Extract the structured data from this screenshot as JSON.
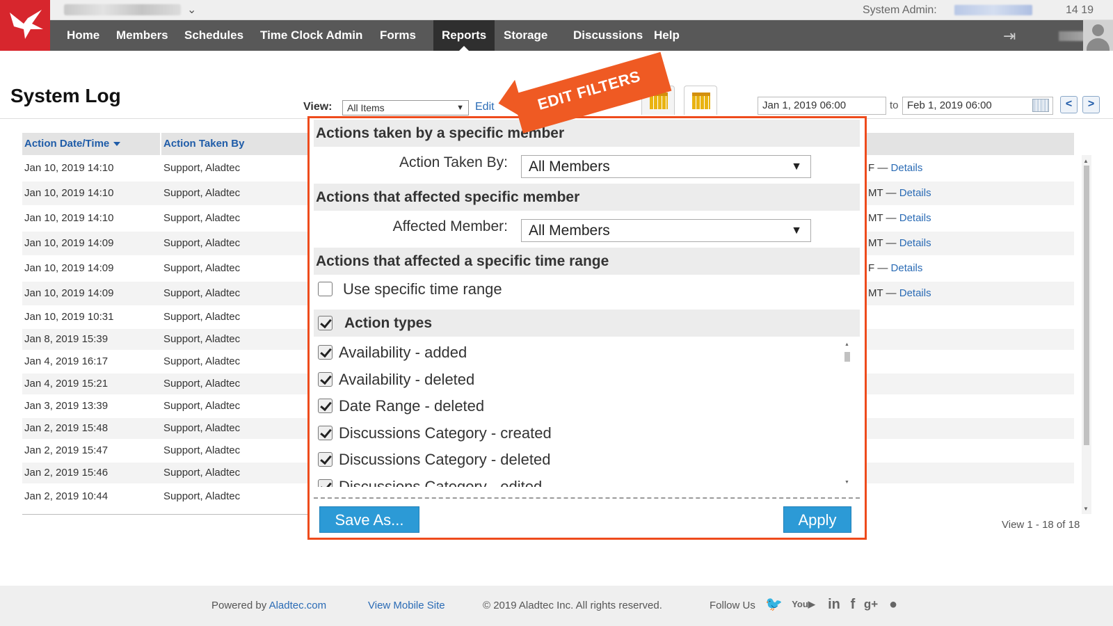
{
  "header": {
    "admin_label": "System Admin:",
    "clock": "14 19"
  },
  "nav": {
    "items": [
      "Home",
      "Members",
      "Schedules",
      "Time Clock Admin",
      "Forms",
      "Reports",
      "Storage",
      "Discussions",
      "Help"
    ],
    "active": "Reports"
  },
  "page": {
    "title": "System Log",
    "view_label": "View:",
    "view_value": "All Items",
    "edit_link": "Edit",
    "date_from": "Jan 1, 2019 06:00",
    "to_label": "to",
    "date_to": "Feb 1, 2019 06:00",
    "prev": "<",
    "next": ">",
    "view_count": "View 1 - 18 of 18"
  },
  "table": {
    "headers": [
      "Action Date/Time",
      "Action Taken By"
    ],
    "rows": [
      {
        "date": "Jan 10, 2019 14:10",
        "by": "Support, Aladtec",
        "suffix": "F —",
        "details": "Details"
      },
      {
        "date": "Jan 10, 2019 14:10",
        "by": "Support, Aladtec",
        "suffix": "MT —",
        "details": "Details"
      },
      {
        "date": "Jan 10, 2019 14:10",
        "by": "Support, Aladtec",
        "suffix": "MT —",
        "details": "Details"
      },
      {
        "date": "Jan 10, 2019 14:09",
        "by": "Support, Aladtec",
        "suffix": "MT —",
        "details": "Details"
      },
      {
        "date": "Jan 10, 2019 14:09",
        "by": "Support, Aladtec",
        "suffix": "F —",
        "details": "Details"
      },
      {
        "date": "Jan 10, 2019 14:09",
        "by": "Support, Aladtec",
        "suffix": "MT —",
        "details": "Details"
      },
      {
        "date": "Jan 10, 2019 10:31",
        "by": "Support, Aladtec",
        "suffix": "",
        "details": ""
      },
      {
        "date": "Jan 8, 2019 15:39",
        "by": "Support, Aladtec",
        "suffix": "",
        "details": ""
      },
      {
        "date": "Jan 4, 2019 16:17",
        "by": "Support, Aladtec",
        "suffix": "",
        "details": ""
      },
      {
        "date": "Jan 4, 2019 15:21",
        "by": "Support, Aladtec",
        "suffix": "",
        "details": ""
      },
      {
        "date": "Jan 3, 2019 13:39",
        "by": "Support, Aladtec",
        "suffix": "",
        "details": ""
      },
      {
        "date": "Jan 2, 2019 15:48",
        "by": "Support, Aladtec",
        "suffix": "",
        "details": ""
      },
      {
        "date": "Jan 2, 2019 15:47",
        "by": "Support, Aladtec",
        "suffix": "",
        "details": ""
      },
      {
        "date": "Jan 2, 2019 15:46",
        "by": "Support, Aladtec",
        "suffix": "",
        "details": ""
      },
      {
        "date": "Jan 2, 2019 10:44",
        "by": "Support, Aladtec",
        "suffix": "",
        "details": ""
      }
    ]
  },
  "filters": {
    "section1": "Actions taken by a specific member",
    "taken_by_label": "Action Taken By:",
    "taken_by_value": "All Members",
    "section2": "Actions that affected specific member",
    "affected_label": "Affected Member:",
    "affected_value": "All Members",
    "section3": "Actions that affected a specific time range",
    "time_range_label": "Use specific time range",
    "time_range_checked": false,
    "action_types_label": "Action types",
    "action_types_checked": true,
    "action_types": [
      {
        "label": "Availability - added",
        "checked": true
      },
      {
        "label": "Availability - deleted",
        "checked": true
      },
      {
        "label": "Date Range - deleted",
        "checked": true
      },
      {
        "label": "Discussions Category - created",
        "checked": true
      },
      {
        "label": "Discussions Category - deleted",
        "checked": true
      },
      {
        "label": "Discussions Category - edited",
        "checked": true
      }
    ],
    "save_as": "Save As...",
    "apply": "Apply"
  },
  "callout": {
    "text": "EDIT FILTERS",
    "color": "#ef5a23"
  },
  "footer": {
    "powered_prefix": "Powered by ",
    "powered_link": "Aladtec.com",
    "mobile": "View Mobile Site",
    "copyright": "© 2019 Aladtec Inc. All rights reserved.",
    "follow": "Follow Us"
  },
  "colors": {
    "brand_red": "#d7262d",
    "link_blue": "#2a6bb5",
    "button_blue": "#2c9ad6",
    "highlight": "#ee4b1c"
  }
}
